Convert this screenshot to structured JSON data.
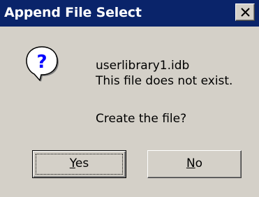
{
  "dialog": {
    "title": "Append File Select",
    "close_icon": "close-icon",
    "icon": "question-icon",
    "filename": "userlibrary1.idb",
    "message": "This file does not exist.",
    "prompt": "Create the file?",
    "buttons": {
      "yes": {
        "mnemonic": "Y",
        "rest": "es"
      },
      "no": {
        "mnemonic": "N",
        "rest": "o"
      }
    }
  },
  "colors": {
    "titlebar": "#0a246a",
    "face": "#d4d0c8"
  }
}
